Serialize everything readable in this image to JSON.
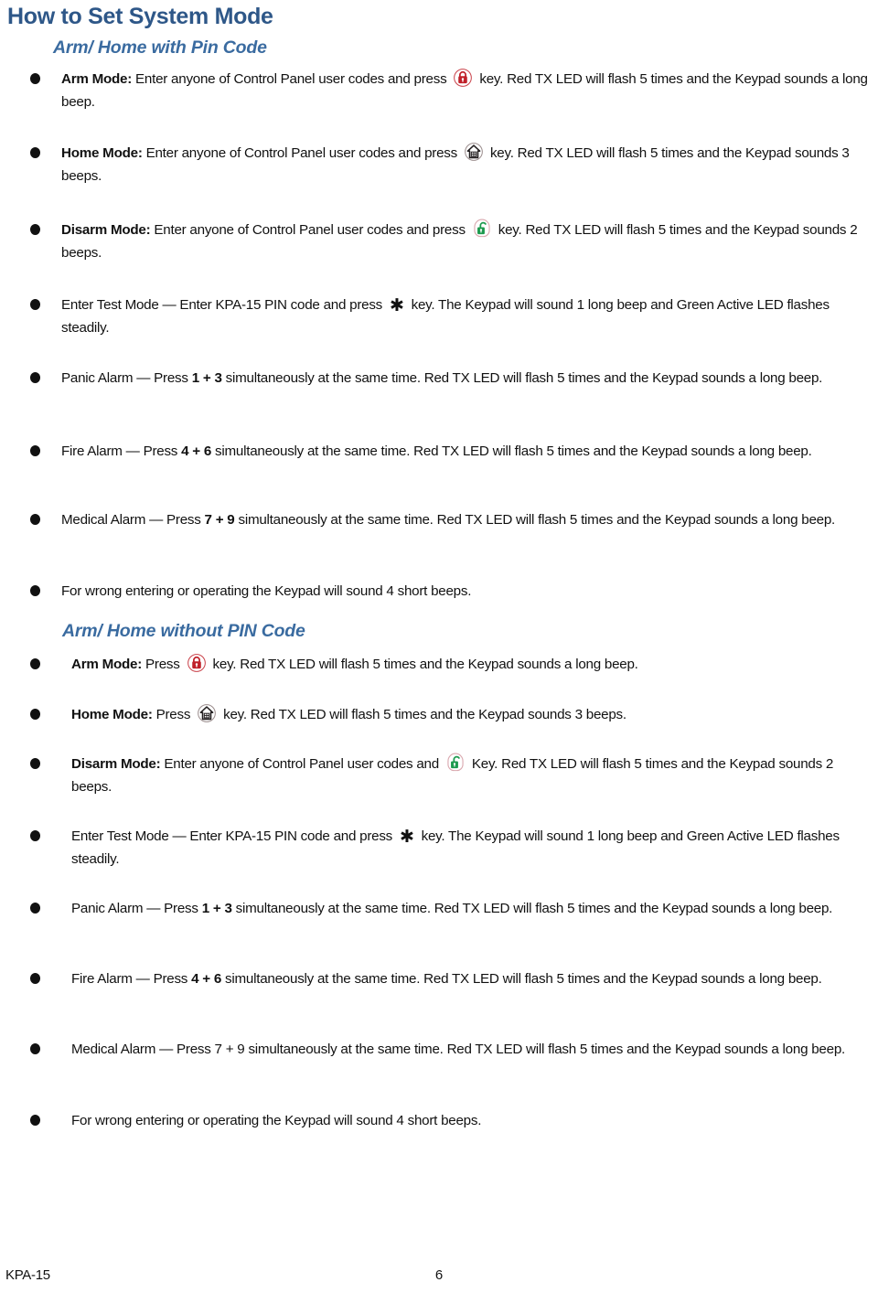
{
  "document": {
    "title": "How to Set System Mode",
    "footer": {
      "left_label": "KPA-15",
      "page_number": "6"
    },
    "colors": {
      "heading": "#2E5788",
      "subheading": "#3A6BA0",
      "arm_icon_red": "#C02029",
      "disarm_icon_green": "#1D9A4E",
      "home_icon_dark": "#231F20",
      "text": "#111111"
    }
  },
  "sections": [
    {
      "heading": "Arm/ Home with Pin Code",
      "items": [
        {
          "label": "Arm Mode",
          "label_suffix": ":",
          "text_before_icon": " Enter anyone of Control Panel user codes and press ",
          "icon": "lock-closed-icon",
          "text_after_icon": " key. Red TX LED will flash 5 times and the Keypad sounds a long beep."
        },
        {
          "label": "Home Mode",
          "label_suffix": ":",
          "text_before_icon": " Enter anyone of Control Panel user codes and press ",
          "icon": "home-icon",
          "text_after_icon": " key. Red TX LED will flash 5 times and the Keypad sounds 3 beeps."
        },
        {
          "label": "Disarm Mode",
          "label_suffix": ":",
          "text_before_icon": " Enter anyone of Control Panel user codes and press ",
          "icon": "lock-open-icon",
          "text_after_icon": " key. Red TX LED will flash 5 times and the Keypad sounds 2 beeps."
        },
        {
          "label": "",
          "label_suffix": "",
          "text_before_icon": "Enter Test Mode — Enter KPA-15 PIN code and press ",
          "icon": "asterisk-key-icon",
          "text_after_icon": " key. The Keypad will sound 1 long beep and Green Active LED flashes steadily."
        },
        {
          "label": "",
          "label_suffix": "",
          "text_before_icon": "Panic Alarm — Press ",
          "icon": "",
          "bold_keys": "1 + 3",
          "text_after_icon": " simultaneously at the same time. Red TX LED will flash 5 times and the Keypad sounds a long beep."
        },
        {
          "label": "",
          "label_suffix": "",
          "text_before_icon": "Fire Alarm — Press ",
          "icon": "",
          "bold_keys": "4 + 6",
          "text_after_icon": " simultaneously at the same time. Red TX LED will flash 5 times and the Keypad sounds a long beep."
        },
        {
          "label": "",
          "label_suffix": "",
          "text_before_icon": "Medical Alarm — Press ",
          "icon": "",
          "bold_keys": "7 + 9",
          "text_after_icon": " simultaneously at the same time. Red TX LED will flash 5 times and the Keypad sounds a long beep."
        },
        {
          "label": "",
          "label_suffix": "",
          "text_before_icon": "For wrong entering or operating the Keypad will sound 4 short beeps.",
          "icon": "",
          "text_after_icon": ""
        }
      ]
    },
    {
      "heading": "Arm/ Home without PIN Code",
      "items": [
        {
          "label": "Arm Mode",
          "label_suffix": ":",
          "text_before_icon": " Press ",
          "icon": "lock-closed-icon",
          "text_after_icon": " key. Red TX LED will flash 5 times and the Keypad sounds a long beep."
        },
        {
          "label": "Home Mode",
          "label_suffix": ":",
          "text_before_icon": " Press ",
          "icon": "home-icon",
          "text_after_icon": " key. Red TX LED will flash 5 times and the Keypad sounds 3 beeps."
        },
        {
          "label": "Disarm Mode",
          "label_suffix": ":",
          "text_before_icon": " Enter anyone of Control Panel user codes and ",
          "icon": "lock-open-icon",
          "text_after_icon": " Key. Red TX LED will flash 5 times and the Keypad sounds 2 beeps."
        },
        {
          "label": "",
          "label_suffix": "",
          "text_before_icon": "Enter Test Mode — Enter KPA-15 PIN code and press ",
          "icon": "asterisk-key-icon",
          "text_after_icon": " key. The Keypad will sound 1 long beep and Green Active LED flashes steadily."
        },
        {
          "label": "",
          "label_suffix": "",
          "text_before_icon": "Panic Alarm — Press ",
          "icon": "",
          "bold_keys": "1 + 3",
          "text_after_icon": " simultaneously at the same time. Red TX LED will flash 5 times and the Keypad sounds a long beep."
        },
        {
          "label": "",
          "label_suffix": "",
          "text_before_icon": "Fire Alarm — Press ",
          "icon": "",
          "bold_keys": "4 + 6",
          "text_after_icon": " simultaneously at the same time. Red TX LED will flash 5 times and the Keypad sounds a long beep."
        },
        {
          "label": "",
          "label_suffix": "",
          "text_before_icon": "Medical Alarm — Press 7 + 9 simultaneously at the same time. Red TX LED will flash 5 times and the Keypad sounds a long beep.",
          "icon": "",
          "text_after_icon": ""
        },
        {
          "label": "",
          "label_suffix": "",
          "text_before_icon": "For wrong entering or operating the Keypad will sound 4 short beeps.",
          "icon": "",
          "text_after_icon": ""
        }
      ]
    }
  ]
}
